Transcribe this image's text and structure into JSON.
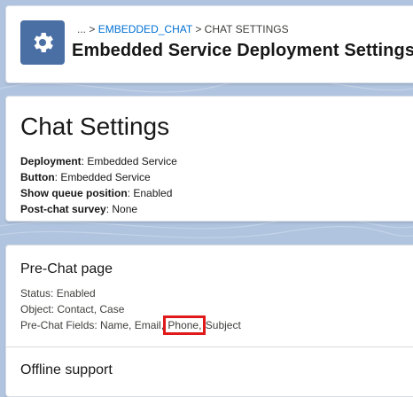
{
  "header": {
    "icon": "gear-icon",
    "breadcrumb": {
      "ellipsis": "...",
      "separator": ">",
      "link": "EMBEDDED_CHAT",
      "current": "CHAT SETTINGS"
    },
    "title": "Embedded Service Deployment Settings"
  },
  "chat_settings": {
    "title": "Chat Settings",
    "fields": [
      {
        "label": "Deployment",
        "value": "Embedded Service"
      },
      {
        "label": "Button",
        "value": "Embedded Service"
      },
      {
        "label": "Show queue position",
        "value": "Enabled"
      },
      {
        "label": "Post-chat survey",
        "value": "None"
      }
    ]
  },
  "prechat": {
    "title": "Pre-Chat page",
    "status": "Status: Enabled",
    "object": "Object: Contact, Case",
    "fields_prefix": "Pre-Chat Fields: Name, Email,",
    "fields_highlighted": "Phone,",
    "fields_suffix": "Subject"
  },
  "offline": {
    "title": "Offline support"
  },
  "colors": {
    "background": "#b0c4df",
    "icon_bg": "#4a6fa5",
    "link": "#0070d2",
    "highlight_border": "#e01a1a"
  }
}
